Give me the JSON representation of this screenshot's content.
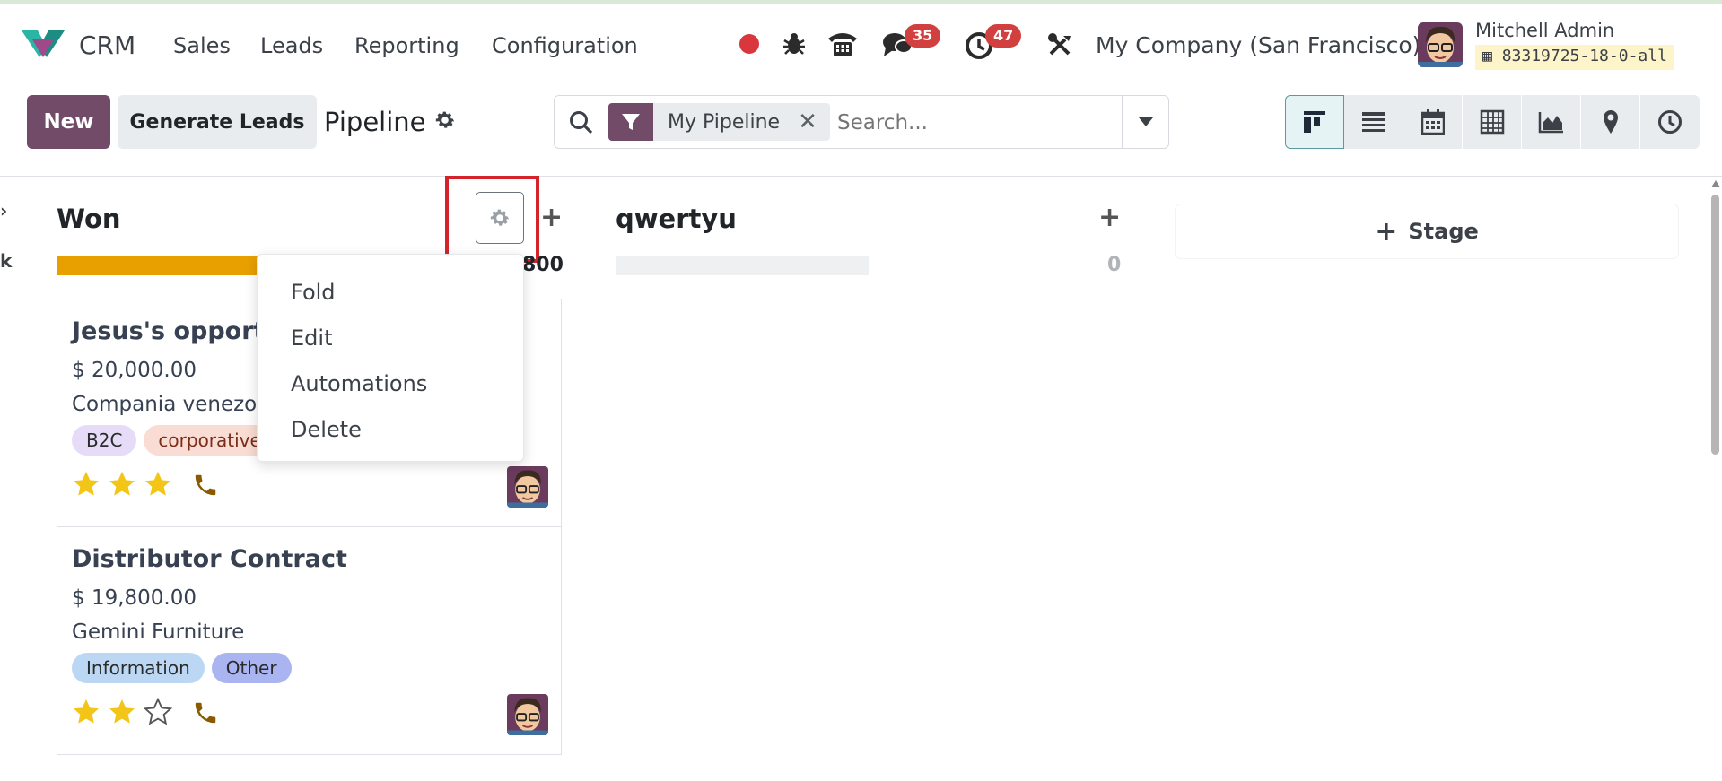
{
  "nav": {
    "app_name": "CRM",
    "menus": [
      "Sales",
      "Leads",
      "Reporting",
      "Configuration"
    ],
    "messages_count": "35",
    "activities_count": "47",
    "company": "My Company (San Francisco)",
    "user_name": "Mitchell Admin",
    "database": "83319725-18-0-all"
  },
  "control": {
    "new_label": "New",
    "generate_label": "Generate Leads",
    "breadcrumb": "Pipeline",
    "facet_label": "My Pipeline",
    "search_placeholder": "Search..."
  },
  "views": [
    "kanban",
    "list",
    "calendar",
    "pivot",
    "graph",
    "map",
    "activity"
  ],
  "kanban": {
    "prev_col_fragment": "k",
    "columns": [
      {
        "title": "Won",
        "total": "800",
        "progress": 1.0,
        "dropdown": [
          "Fold",
          "Edit",
          "Automations",
          "Delete"
        ],
        "cards": [
          {
            "title": "Jesus's opportunity",
            "amount": "$ 20,000.00",
            "partner": "Compania venezolana",
            "tags": [
              {
                "label": "B2C",
                "color": "#e6dcf7"
              },
              {
                "label": "corporative",
                "color": "#f9dcd3"
              }
            ],
            "stars": 3
          },
          {
            "title": "Distributor Contract",
            "amount": "$ 19,800.00",
            "partner": "Gemini Furniture",
            "tags": [
              {
                "label": "Information",
                "color": "#bcd7f4"
              },
              {
                "label": "Other",
                "color": "#a9b4f0"
              }
            ],
            "stars": 2
          }
        ]
      },
      {
        "title": "qwertyu",
        "total": "0",
        "progress": 0.0,
        "cards": []
      }
    ],
    "add_stage_label": "Stage"
  },
  "colors": {
    "brand": "#714b67",
    "badge": "#d23f3f",
    "won_bar": "#e8a000",
    "star": "#f3c517",
    "phone": "#8a5a00",
    "highlight": "#d4232b"
  }
}
